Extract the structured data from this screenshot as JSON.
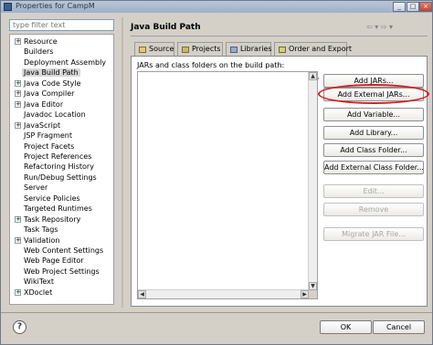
{
  "window": {
    "title": "Properties for CampM",
    "controls": [
      "minimize",
      "maximize",
      "close"
    ],
    "control_glyphs": {
      "minimize": "_",
      "maximize": "□",
      "close": "×"
    }
  },
  "sidebar": {
    "filter_placeholder": "type filter text",
    "items": [
      {
        "label": "Resource",
        "expandable": true
      },
      {
        "label": "Builders",
        "expandable": false
      },
      {
        "label": "Deployment Assembly",
        "expandable": false
      },
      {
        "label": "Java Build Path",
        "expandable": false,
        "selected": true
      },
      {
        "label": "Java Code Style",
        "expandable": true
      },
      {
        "label": "Java Compiler",
        "expandable": true
      },
      {
        "label": "Java Editor",
        "expandable": true
      },
      {
        "label": "Javadoc Location",
        "expandable": false
      },
      {
        "label": "JavaScript",
        "expandable": true
      },
      {
        "label": "JSP Fragment",
        "expandable": false
      },
      {
        "label": "Project Facets",
        "expandable": false
      },
      {
        "label": "Project References",
        "expandable": false
      },
      {
        "label": "Refactoring History",
        "expandable": false
      },
      {
        "label": "Run/Debug Settings",
        "expandable": false
      },
      {
        "label": "Server",
        "expandable": false
      },
      {
        "label": "Service Policies",
        "expandable": false
      },
      {
        "label": "Targeted Runtimes",
        "expandable": false
      },
      {
        "label": "Task Repository",
        "expandable": true
      },
      {
        "label": "Task Tags",
        "expandable": false
      },
      {
        "label": "Validation",
        "expandable": true
      },
      {
        "label": "Web Content Settings",
        "expandable": false
      },
      {
        "label": "Web Page Editor",
        "expandable": false
      },
      {
        "label": "Web Project Settings",
        "expandable": false
      },
      {
        "label": "WikiText",
        "expandable": false
      },
      {
        "label": "XDoclet",
        "expandable": true
      }
    ]
  },
  "page": {
    "title": "Java Build Path",
    "nav_arrows": "⇦ ▾ ⇨ ▾"
  },
  "tabs": [
    {
      "label": "Source",
      "icon": "source-folder-icon",
      "active": false
    },
    {
      "label": "Projects",
      "icon": "project-icon",
      "active": false
    },
    {
      "label": "Libraries",
      "icon": "library-icon",
      "active": true
    },
    {
      "label": "Order and Export",
      "icon": "order-export-icon",
      "active": false
    }
  ],
  "libraries": {
    "caption": "JARs and class folders on the build path:"
  },
  "buttons": [
    {
      "label": "Add JARs...",
      "enabled": true
    },
    {
      "label": "Add External JARs...",
      "enabled": true,
      "highlighted": true
    },
    {
      "label": "Add Variable...",
      "enabled": true
    },
    {
      "label": "Add Library...",
      "enabled": true
    },
    {
      "label": "Add Class Folder...",
      "enabled": true
    },
    {
      "label": "Add External Class Folder...",
      "enabled": true
    },
    {
      "label": "Edit...",
      "enabled": false
    },
    {
      "label": "Remove",
      "enabled": false
    },
    {
      "label": "Migrate JAR File...",
      "enabled": false
    }
  ],
  "highlight_color": "#d11f1f",
  "footer": {
    "help_symbol": "?",
    "ok_label": "OK",
    "cancel_label": "Cancel"
  }
}
